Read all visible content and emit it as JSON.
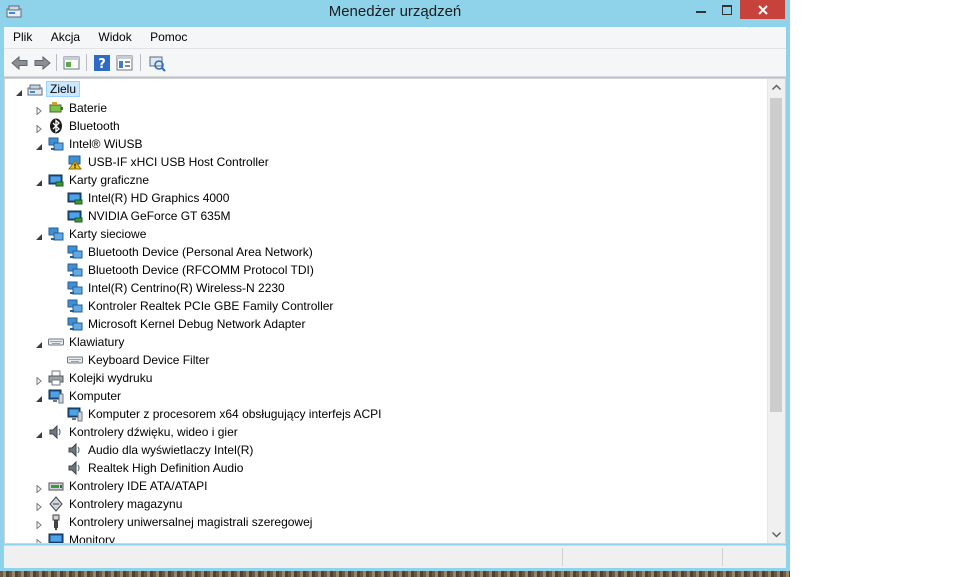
{
  "window": {
    "title": "Menedżer urządzeń"
  },
  "menu": [
    "Plik",
    "Akcja",
    "Widok",
    "Pomoc"
  ],
  "toolbar": [
    "back-icon",
    "forward-icon",
    "properties-view-icon",
    "help-icon",
    "show-hidden-icon",
    "scan-hardware-icon"
  ],
  "colors": {
    "accent": "#8ed3ea",
    "close": "#c7423a",
    "selection": "#cce8ff"
  },
  "tree": {
    "root": "Zielu",
    "items": [
      {
        "label": "Baterie",
        "level": 1,
        "expanded": false,
        "icon": "battery-icon"
      },
      {
        "label": "Bluetooth",
        "level": 1,
        "expanded": false,
        "icon": "bluetooth-icon"
      },
      {
        "label": "Intel® WiUSB",
        "level": 1,
        "expanded": true,
        "icon": "network-icon"
      },
      {
        "label": "USB-IF xHCI USB Host Controller",
        "level": 2,
        "icon": "warning-device-icon"
      },
      {
        "label": "Karty graficzne",
        "level": 1,
        "expanded": true,
        "icon": "display-adapter-icon"
      },
      {
        "label": "Intel(R) HD Graphics 4000",
        "level": 2,
        "icon": "display-adapter-icon"
      },
      {
        "label": "NVIDIA GeForce GT 635M",
        "level": 2,
        "icon": "display-adapter-icon"
      },
      {
        "label": "Karty sieciowe",
        "level": 1,
        "expanded": true,
        "icon": "network-icon"
      },
      {
        "label": "Bluetooth Device (Personal Area Network)",
        "level": 2,
        "icon": "network-icon"
      },
      {
        "label": "Bluetooth Device (RFCOMM Protocol TDI)",
        "level": 2,
        "icon": "network-icon"
      },
      {
        "label": "Intel(R) Centrino(R) Wireless-N 2230",
        "level": 2,
        "icon": "network-icon"
      },
      {
        "label": "Kontroler Realtek PCIe GBE Family Controller",
        "level": 2,
        "icon": "network-icon"
      },
      {
        "label": "Microsoft Kernel Debug Network Adapter",
        "level": 2,
        "icon": "network-icon"
      },
      {
        "label": "Klawiatury",
        "level": 1,
        "expanded": true,
        "icon": "keyboard-icon"
      },
      {
        "label": "Keyboard Device Filter",
        "level": 2,
        "icon": "keyboard-icon"
      },
      {
        "label": "Kolejki wydruku",
        "level": 1,
        "expanded": false,
        "icon": "printer-icon"
      },
      {
        "label": "Komputer",
        "level": 1,
        "expanded": true,
        "icon": "computer-icon"
      },
      {
        "label": "Komputer z procesorem x64 obsługujący interfejs ACPI",
        "level": 2,
        "icon": "computer-icon"
      },
      {
        "label": "Kontrolery dźwięku, wideo i gier",
        "level": 1,
        "expanded": true,
        "icon": "speaker-icon"
      },
      {
        "label": "Audio dla wyświetlaczy Intel(R)",
        "level": 2,
        "icon": "speaker-icon"
      },
      {
        "label": "Realtek High Definition Audio",
        "level": 2,
        "icon": "speaker-icon"
      },
      {
        "label": "Kontrolery IDE ATA/ATAPI",
        "level": 1,
        "expanded": false,
        "icon": "ide-controller-icon"
      },
      {
        "label": "Kontrolery magazynu",
        "level": 1,
        "expanded": false,
        "icon": "storage-controller-icon"
      },
      {
        "label": "Kontrolery uniwersalnej magistrali szeregowej",
        "level": 1,
        "expanded": false,
        "icon": "usb-icon"
      },
      {
        "label": "Monitory",
        "level": 1,
        "expanded": false,
        "icon": "monitor-icon"
      }
    ]
  }
}
